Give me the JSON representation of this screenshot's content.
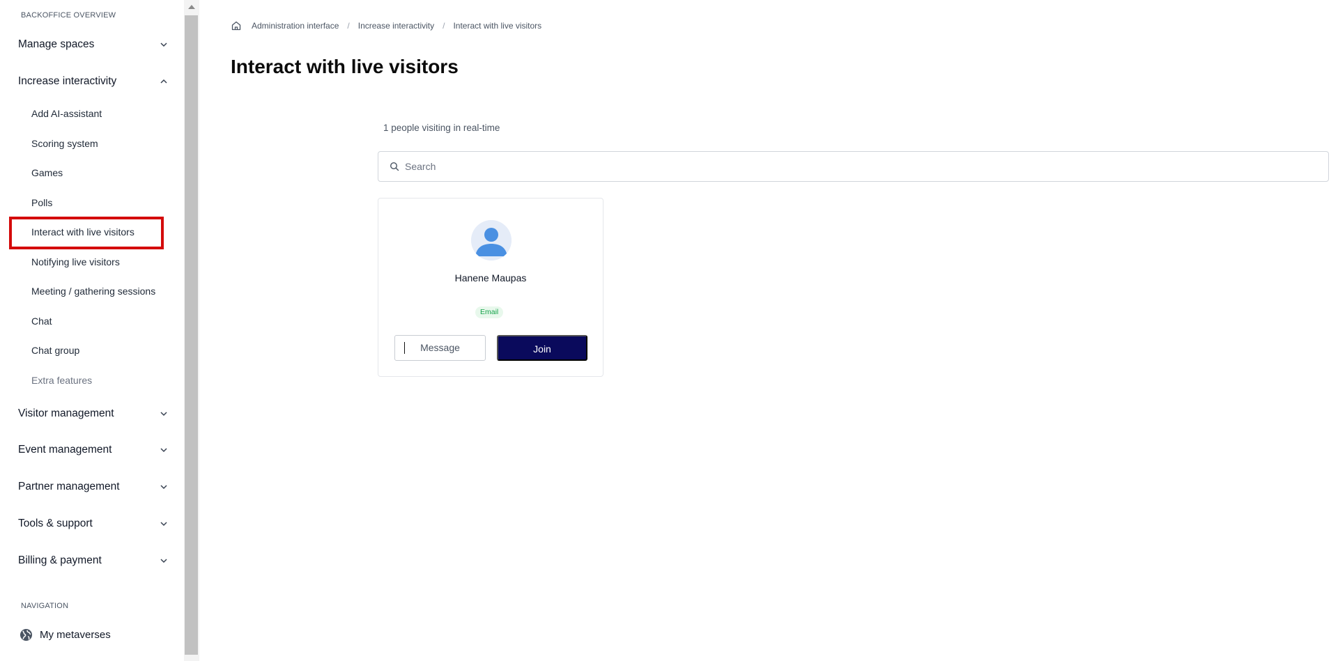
{
  "sidebar": {
    "section_title": "BACKOFFICE OVERVIEW",
    "groups": [
      {
        "label": "Manage spaces",
        "expanded": false
      },
      {
        "label": "Increase interactivity",
        "expanded": true
      },
      {
        "label": "Visitor management",
        "expanded": false
      },
      {
        "label": "Event management",
        "expanded": false
      },
      {
        "label": "Partner management",
        "expanded": false
      },
      {
        "label": "Tools & support",
        "expanded": false
      },
      {
        "label": "Billing & payment",
        "expanded": false
      }
    ],
    "subitems": [
      {
        "label": "Add AI-assistant"
      },
      {
        "label": "Scoring system"
      },
      {
        "label": "Games"
      },
      {
        "label": "Polls"
      },
      {
        "label": "Interact with live visitors",
        "active": true
      },
      {
        "label": "Notifying live visitors"
      },
      {
        "label": "Meeting / gathering sessions"
      },
      {
        "label": "Chat"
      },
      {
        "label": "Chat group"
      },
      {
        "label": "Extra features",
        "muted": true
      }
    ],
    "navigation_title": "NAVIGATION",
    "navigation_items": [
      {
        "label": "My metaverses",
        "icon": "globe-icon"
      }
    ]
  },
  "breadcrumb": {
    "home_icon": "home-icon",
    "items": [
      "Administration interface",
      "Increase interactivity",
      "Interact with live visitors"
    ],
    "separator": "/"
  },
  "page": {
    "title": "Interact with live visitors",
    "visiting_text": "1 people visiting in real-time",
    "search_placeholder": "Search"
  },
  "visitors": [
    {
      "name": "Hanene Maupas",
      "badge": "Email",
      "message_label": "Message",
      "join_label": "Join"
    }
  ],
  "colors": {
    "highlight": "#d40b0b",
    "join_button": "#0a0a5c",
    "badge_bg": "#e8f8ec",
    "badge_text": "#16a34a",
    "avatar_accent": "#4a90e2"
  }
}
